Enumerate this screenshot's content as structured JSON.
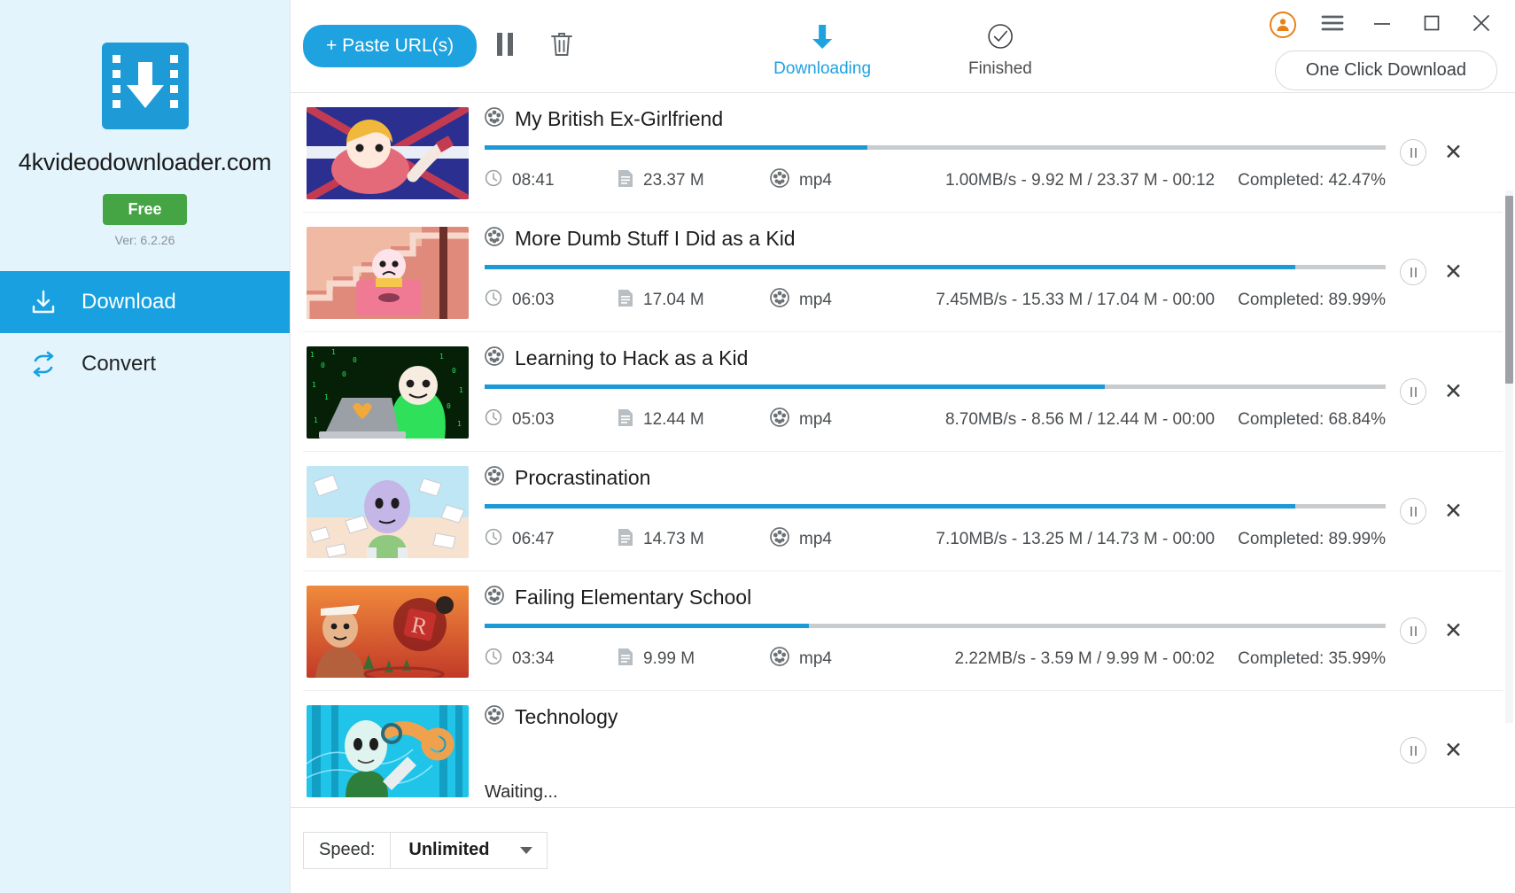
{
  "sidebar": {
    "brand": "4kvideodownloader.com",
    "badge": "Free",
    "version": "Ver: 6.2.26",
    "logo_icon": "film-download-icon",
    "items": [
      {
        "label": "Download",
        "icon": "download-tray-icon",
        "active": true
      },
      {
        "label": "Convert",
        "icon": "convert-arrows-icon",
        "active": false
      }
    ]
  },
  "titlebar": {
    "account_icon": "account-person-icon",
    "menu_icon": "hamburger-menu-icon",
    "minimize_icon": "minimize-icon",
    "maximize_icon": "maximize-icon",
    "close_icon": "close-icon"
  },
  "toolbar": {
    "paste_label": "+ Paste URL(s)",
    "pause_all_icon": "pause-icon",
    "delete_icon": "trash-icon",
    "one_click_label": "One Click Download",
    "tabs": [
      {
        "label": "Downloading",
        "icon": "down-arrow-icon",
        "active": true
      },
      {
        "label": "Finished",
        "icon": "check-circle-icon",
        "active": false
      }
    ]
  },
  "colors": {
    "accent": "#1fa2e0",
    "sidebar_bg": "#e3f4fd",
    "progress_fill": "#1b9ad6",
    "progress_track": "#c9ccce",
    "free_badge": "#45a545",
    "account_orange": "#e8801a"
  },
  "downloads": [
    {
      "title": "My British Ex-Girlfriend",
      "duration": "08:41",
      "size": "23.37 M",
      "format": "mp4",
      "speed_line": "1.00MB/s - 9.92 M / 23.37 M - 00:12",
      "completed": "Completed: 42.47%",
      "percent": 42.47,
      "status": "downloading",
      "thumb": "girl-lying-union-jack"
    },
    {
      "title": "More Dumb Stuff I Did as a Kid",
      "duration": "06:03",
      "size": "17.04 M",
      "format": "mp4",
      "speed_line": "7.45MB/s - 15.33 M / 17.04 M - 00:00",
      "completed": "Completed: 89.99%",
      "percent": 89.99,
      "status": "downloading",
      "thumb": "kid-in-box-on-stairs"
    },
    {
      "title": "Learning to Hack as a Kid",
      "duration": "05:03",
      "size": "12.44 M",
      "format": "mp4",
      "speed_line": "8.70MB/s - 8.56 M / 12.44 M - 00:00",
      "completed": "Completed: 68.84%",
      "percent": 68.84,
      "status": "downloading",
      "thumb": "green-hoodie-hacker-laptop"
    },
    {
      "title": "Procrastination",
      "duration": "06:47",
      "size": "14.73 M",
      "format": "mp4",
      "speed_line": "7.10MB/s - 13.25 M / 14.73 M - 00:00",
      "completed": "Completed: 89.99%",
      "percent": 89.99,
      "status": "downloading",
      "thumb": "character-with-flying-papers"
    },
    {
      "title": "Failing Elementary School",
      "duration": "03:34",
      "size": "9.99 M",
      "format": "mp4",
      "speed_line": "2.22MB/s - 3.59 M / 9.99 M - 00:02",
      "completed": "Completed: 35.99%",
      "percent": 35.99,
      "status": "downloading",
      "thumb": "sunset-character-roblox-logo"
    },
    {
      "title": "Technology",
      "duration": "",
      "size": "",
      "format": "",
      "speed_line": "",
      "completed": "",
      "percent": 0,
      "status": "Waiting...",
      "thumb": "robot-arm-character"
    }
  ],
  "bottom": {
    "speed_label": "Speed:",
    "speed_value": "Unlimited"
  }
}
